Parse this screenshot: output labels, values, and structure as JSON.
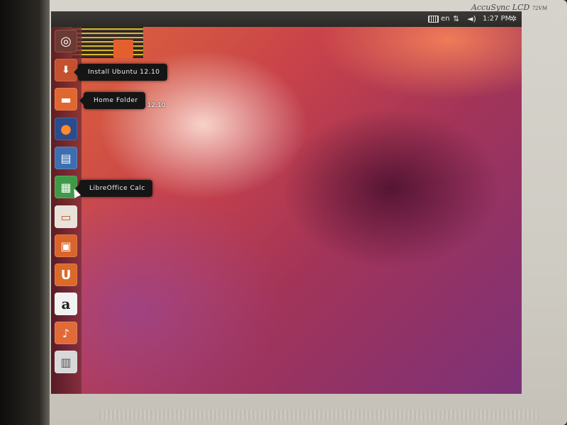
{
  "monitor": {
    "brand": "AccuSync LCD",
    "model": "72VM"
  },
  "panel": {
    "keyboard_layout": "en",
    "clock": "1:27 PM",
    "icons": [
      "keyboard-icon",
      "network-icon",
      "volume-icon",
      "gear-icon"
    ]
  },
  "launcher": {
    "items": [
      {
        "name": "ubuntu-dash",
        "icon": "ubuntu-logo-icon",
        "color": "#8a4a3a"
      },
      {
        "name": "ubuntu-installer",
        "icon": "installer-icon",
        "color": "#c4512f"
      },
      {
        "name": "home-folder",
        "icon": "folder-icon",
        "color": "#e0672f"
      },
      {
        "name": "firefox",
        "icon": "firefox-icon",
        "color": "#2b4b8a"
      },
      {
        "name": "libreoffice-writer",
        "icon": "writer-icon",
        "color": "#3d6fb0"
      },
      {
        "name": "libreoffice-calc",
        "icon": "calc-icon",
        "color": "#3f9a47"
      },
      {
        "name": "libreoffice-impress",
        "icon": "impress-icon",
        "color": "#e8e2d8"
      },
      {
        "name": "ubuntu-software-center",
        "icon": "software-center-icon",
        "color": "#d9652b"
      },
      {
        "name": "ubuntu-one",
        "icon": "ubuntu-one-icon",
        "color": "#d96a2a"
      },
      {
        "name": "amazon",
        "icon": "amazon-icon",
        "color": "#f2f2f2",
        "glyph": "a"
      },
      {
        "name": "ubuntu-one-music",
        "icon": "music-icon",
        "color": "#e06a38"
      },
      {
        "name": "workspaces",
        "icon": "workspaces-icon",
        "color": "#d8d8d8"
      }
    ]
  },
  "tooltips": {
    "installer": "Install Ubuntu 12.10",
    "home": "Home Folder",
    "calc": "LibreOffice Calc"
  },
  "desktop": {
    "label": "Install Ubuntu 12.10"
  }
}
